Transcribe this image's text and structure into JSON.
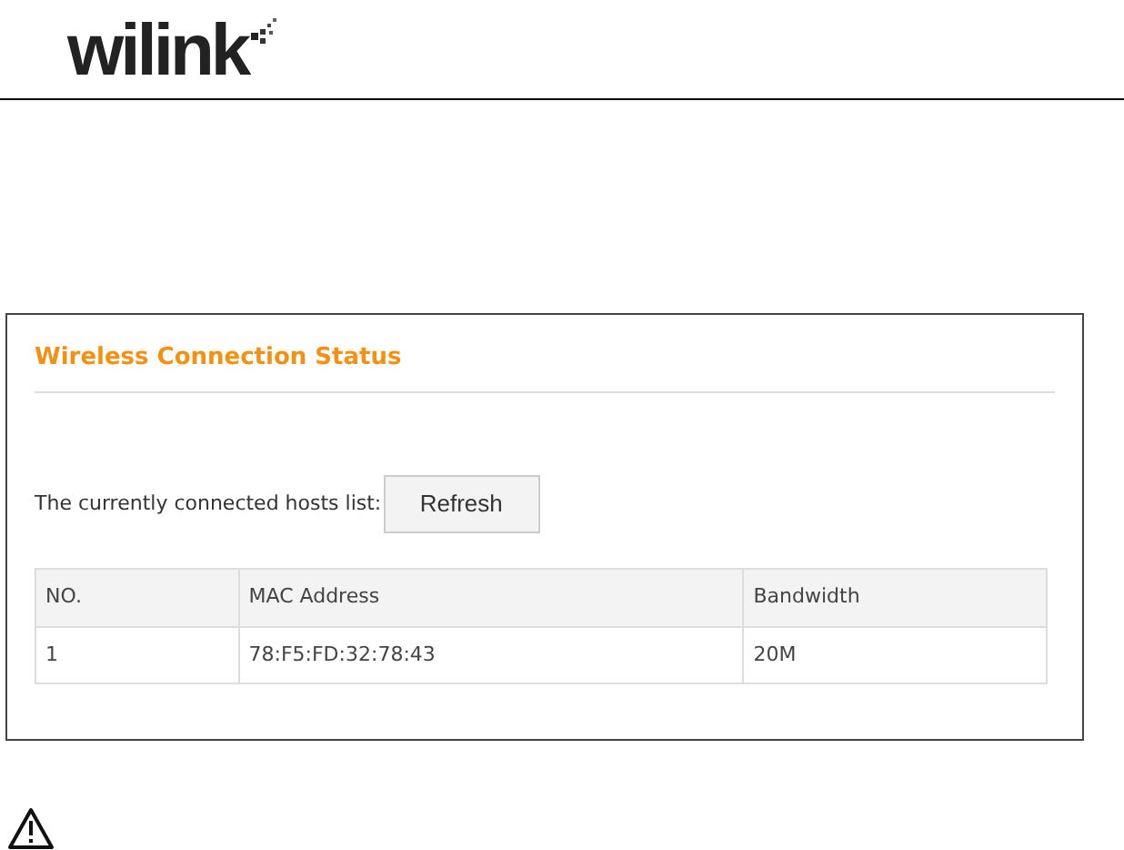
{
  "header": {
    "logo": "wilink"
  },
  "panel": {
    "title": "Wireless Connection Status",
    "hosts_label": "The currently connected hosts list:",
    "refresh_button": "Refresh",
    "table": {
      "columns": [
        "NO.",
        "MAC Address",
        "Bandwidth"
      ],
      "rows": [
        [
          "1",
          "78:F5:FD:32:78:43",
          "20M"
        ]
      ]
    }
  }
}
